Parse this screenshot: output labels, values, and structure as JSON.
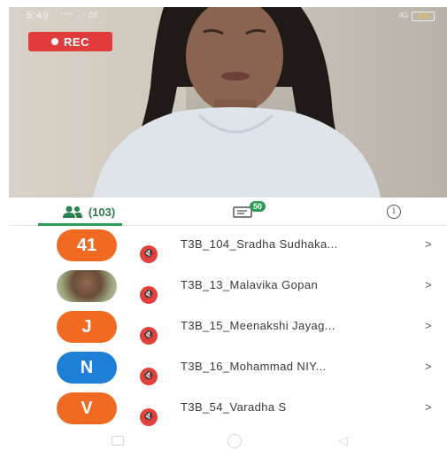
{
  "status_bar": {
    "time": "5:49",
    "signal_text": "°⁺º¹ …¹ 28",
    "network_text": "4G",
    "battery_text": "100"
  },
  "video": {
    "rec_label": "REC"
  },
  "tabs": {
    "participants_count": "(103)",
    "chat_badge": "50"
  },
  "participants": [
    {
      "avatar_text": "41",
      "avatar_color": "#f06a22",
      "name": "T3B_104_Sradha Sudhaka...",
      "chevron": ">"
    },
    {
      "avatar_text": "",
      "avatar_color": "photo",
      "name": "T3B_13_Malavika Gopan",
      "chevron": ">"
    },
    {
      "avatar_text": "J",
      "avatar_color": "#f06a22",
      "name": "T3B_15_Meenakshi Jayag...",
      "chevron": ">"
    },
    {
      "avatar_text": "N",
      "avatar_color": "#1e7fd6",
      "name": "T3B_16_Mohammad NIY...",
      "chevron": ">"
    },
    {
      "avatar_text": "V",
      "avatar_color": "#f06a22",
      "name": "T3B_54_Varadha S",
      "chevron": ">"
    }
  ]
}
